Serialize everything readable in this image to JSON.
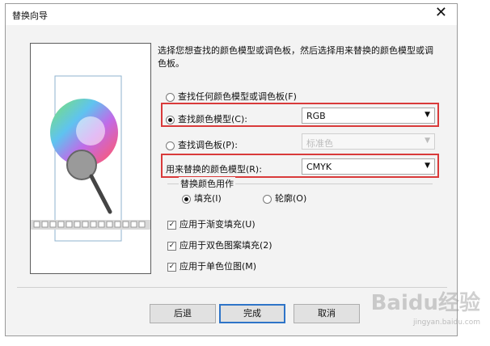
{
  "dialog": {
    "title": "替换向导"
  },
  "instructions": "选择您想查找的颜色模型或调色板，然后选择用来替换的颜色模型或调色板。",
  "options": {
    "find_any": "查找任何颜色模型或调色板(F)",
    "find_model": "查找颜色模型(C):",
    "find_palette": "查找调色板(P):",
    "replace_model": "用来替换的颜色模型(R):"
  },
  "selects": {
    "find_model_value": "RGB",
    "find_palette_value": "标准色",
    "replace_model_value": "CMYK"
  },
  "replace_group": {
    "title": "替换颜色用作",
    "fill": "填充(I)",
    "outline": "轮廓(O)"
  },
  "checks": [
    {
      "label": "应用于渐变填充(U)",
      "checked": true
    },
    {
      "label": "应用于双色图案填充(2)",
      "checked": true
    },
    {
      "label": "应用于单色位图(M)",
      "checked": true
    }
  ],
  "buttons": {
    "back": "后退",
    "finish": "完成",
    "cancel": "取消"
  },
  "watermark": {
    "text": "Baidu经验",
    "url": "jingyan.baidu.com"
  },
  "colors": {
    "highlight": "#d93a3a",
    "default_button_border": "#2e74c8"
  }
}
